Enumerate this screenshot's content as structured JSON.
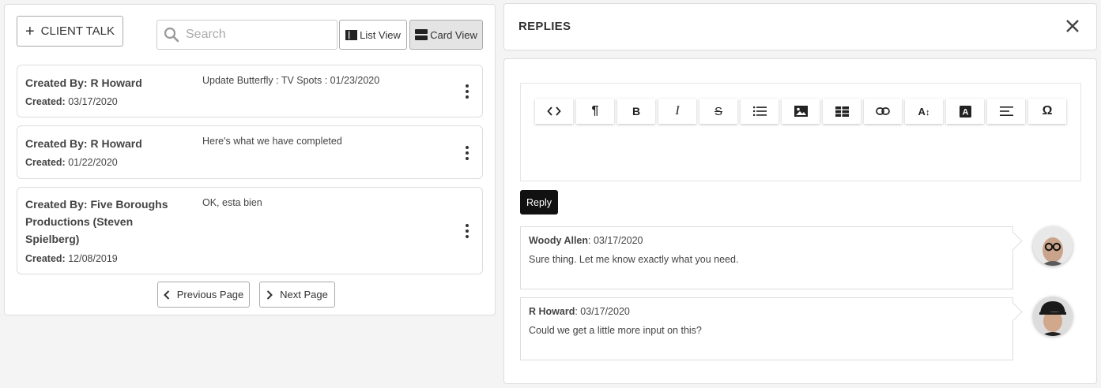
{
  "left": {
    "client_talk_label": "CLIENT TALK",
    "search_placeholder": "Search",
    "list_view_label": "List View",
    "card_view_label": "Card View",
    "cards": [
      {
        "author": "Created By: R Howard",
        "created_label": "Created:",
        "created_date": "03/17/2020",
        "subject": "Update Butterfly : TV Spots : 01/23/2020"
      },
      {
        "author": "Created By: R Howard",
        "created_label": "Created:",
        "created_date": "01/22/2020",
        "subject": "Here's what we have completed"
      },
      {
        "author": "Created By: Five Boroughs Productions (Steven Spielberg)",
        "created_label": "Created:",
        "created_date": "12/08/2019",
        "subject": "OK, esta bien"
      }
    ],
    "prev_label": "Previous Page",
    "next_label": "Next Page"
  },
  "replies": {
    "title": "REPLIES",
    "toolbar": [
      "code-view",
      "paragraph",
      "bold",
      "italic",
      "strikethrough",
      "list",
      "image",
      "table",
      "link",
      "font-size",
      "font-color",
      "align",
      "special-chars"
    ],
    "reply_label": "Reply",
    "comments": [
      {
        "name": "Woody Allen",
        "date": ": 03/17/2020",
        "text": "Sure thing. Let me know exactly what you need."
      },
      {
        "name": "R Howard",
        "date": ": 03/17/2020",
        "text": "Could we get a little more input on this?"
      }
    ]
  }
}
